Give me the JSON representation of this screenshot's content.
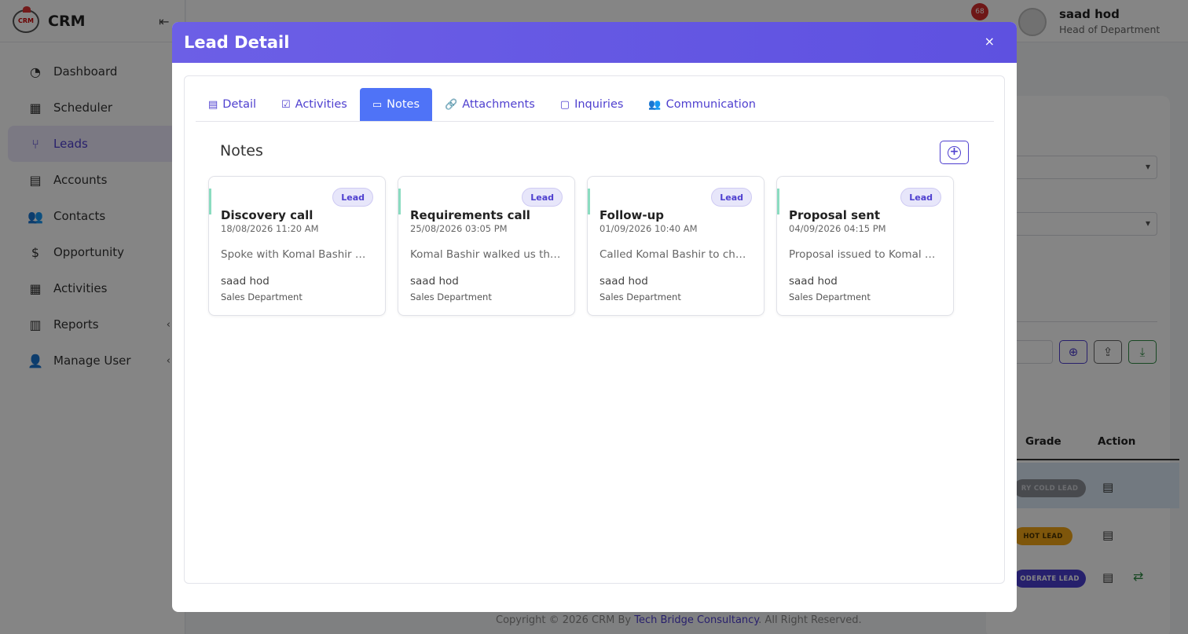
{
  "app": {
    "brand": "CRM",
    "logo_text": "CRM"
  },
  "sidebar": {
    "items": [
      {
        "label": "Dashboard",
        "icon": "gauge-icon",
        "glyph": "◔"
      },
      {
        "label": "Scheduler",
        "icon": "calendar-icon",
        "glyph": "▦"
      },
      {
        "label": "Leads",
        "icon": "branch-icon",
        "glyph": "⑂",
        "active": true
      },
      {
        "label": "Accounts",
        "icon": "archive-icon",
        "glyph": "▤"
      },
      {
        "label": "Contacts",
        "icon": "users-icon",
        "glyph": "👥"
      },
      {
        "label": "Opportunity",
        "icon": "dollar-icon",
        "glyph": "$"
      },
      {
        "label": "Activities",
        "icon": "calendar-icon",
        "glyph": "▦"
      },
      {
        "label": "Reports",
        "icon": "bar-chart-icon",
        "glyph": "▥",
        "chevron": "‹"
      },
      {
        "label": "Manage User",
        "icon": "user-icon",
        "glyph": "👤",
        "chevron": "‹"
      }
    ]
  },
  "header": {
    "notifications_count": "68",
    "user_name": "saad hod",
    "user_role": "Head of Department"
  },
  "background_table": {
    "columns": [
      "Grade",
      "Action"
    ],
    "rows": [
      {
        "grade": "VERY COLD LEAD",
        "grade_visible": "RY COLD LEAD"
      },
      {
        "grade": "HOT LEAD",
        "grade_visible": "HOT LEAD"
      },
      {
        "grade": "MODERATE LEAD",
        "grade_visible": "ODERATE LEAD"
      }
    ]
  },
  "footer": {
    "prefix": "Copyright © 2026 CRM By ",
    "link": "Tech Bridge Consultancy",
    "suffix": ". All Right Reserved."
  },
  "modal": {
    "title": "Lead Detail",
    "close": "×",
    "tabs": [
      {
        "label": "Detail",
        "icon": "document-icon",
        "glyph": "▤"
      },
      {
        "label": "Activities",
        "icon": "clipboard-check-icon",
        "glyph": "☑"
      },
      {
        "label": "Notes",
        "icon": "comment-icon",
        "glyph": "▭",
        "active": true
      },
      {
        "label": "Attachments",
        "icon": "link-icon",
        "glyph": "🔗"
      },
      {
        "label": "Inquiries",
        "icon": "chat-icon",
        "glyph": "▢"
      },
      {
        "label": "Communication",
        "icon": "users-icon",
        "glyph": "👥"
      }
    ],
    "notes_heading": "Notes",
    "add_button": "+",
    "notes": [
      {
        "tag": "Lead",
        "title": "Discovery call",
        "date": "18/08/2026 11:20 AM",
        "desc": "Spoke with Komal Bashir about their requirements",
        "author": "saad hod",
        "department": "Sales Department"
      },
      {
        "tag": "Lead",
        "title": "Requirements call",
        "date": "25/08/2026 03:05 PM",
        "desc": "Komal Bashir walked us through the requirements",
        "author": "saad hod",
        "department": "Sales Department"
      },
      {
        "tag": "Lead",
        "title": "Follow-up",
        "date": "01/09/2026 10:40 AM",
        "desc": "Called Komal Bashir to check on progress",
        "author": "saad hod",
        "department": "Sales Department"
      },
      {
        "tag": "Lead",
        "title": "Proposal sent",
        "date": "04/09/2026 04:15 PM",
        "desc": "Proposal issued to Komal Bashir for review",
        "author": "saad hod",
        "department": "Sales Department"
      }
    ]
  }
}
